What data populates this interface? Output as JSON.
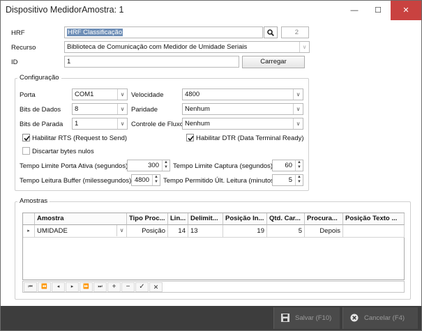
{
  "window": {
    "title": "Dispositivo MedidorAmostra: 1",
    "minimize_glyph": "—",
    "maximize_glyph": "☐",
    "close_glyph": "✕"
  },
  "form": {
    "hrf_label": "HRF",
    "hrf_value": "HRF Classificação",
    "hrf_search_icon": "search-icon",
    "hrf_code": "2",
    "recurso_label": "Recurso",
    "recurso_value": "Biblioteca de Comunicação com Medidor de Umidade Seriais",
    "id_label": "ID",
    "id_value": "1",
    "carregar_label": "Carregar"
  },
  "configuracao": {
    "title": "Configuração",
    "porta_label": "Porta",
    "porta_value": "COM1",
    "velocidade_label": "Velocidade",
    "velocidade_value": "4800",
    "bits_dados_label": "Bits de Dados",
    "bits_dados_value": "8",
    "paridade_label": "Paridade",
    "paridade_value": "Nenhum",
    "bits_parada_label": "Bits de Parada",
    "bits_parada_value": "1",
    "controle_fluxo_label": "Controle de Fluxo",
    "controle_fluxo_value": "Nenhum",
    "rts_label": "Habilitar RTS (Request to Send)",
    "rts_checked": true,
    "dtr_label": "Habilitar DTR (Data Terminal Ready)",
    "dtr_checked": true,
    "discartar_label": "Discartar bytes nulos",
    "discartar_checked": false,
    "tempo_porta_label": "Tempo Limite Porta Ativa (segundos)",
    "tempo_porta_value": "300",
    "tempo_captura_label": "Tempo Limite Captura (segundos)",
    "tempo_captura_value": "60",
    "tempo_buffer_label": "Tempo Leitura Buffer (milessegundos)",
    "tempo_buffer_value": "4800",
    "tempo_ult_label": "Tempo Permitido Últ. Leitura (minutos)",
    "tempo_ult_value": "5"
  },
  "amostras": {
    "title": "Amostras",
    "columns": [
      "Amostra",
      "Tipo Proc...",
      "Lin...",
      "Delimit...",
      "Posição In...",
      "Qtd. Car...",
      "Procura...",
      "Posição Texto ..."
    ],
    "rows": [
      {
        "indicator": "▸",
        "amostra": "UMIDADE",
        "tipo": "Posição",
        "linha": "14",
        "delimitador": "13",
        "posicao_inicial": "19",
        "qtd_caracteres": "5",
        "procura": "Depois",
        "posicao_texto": ""
      }
    ],
    "nav": [
      "⏮",
      "⏪",
      "◂",
      "▸",
      "⏩",
      "⏭",
      "+",
      "−",
      "✓",
      "✕"
    ]
  },
  "footer": {
    "salvar_label": "Salvar (F10)",
    "cancelar_label": "Cancelar (F4)"
  }
}
